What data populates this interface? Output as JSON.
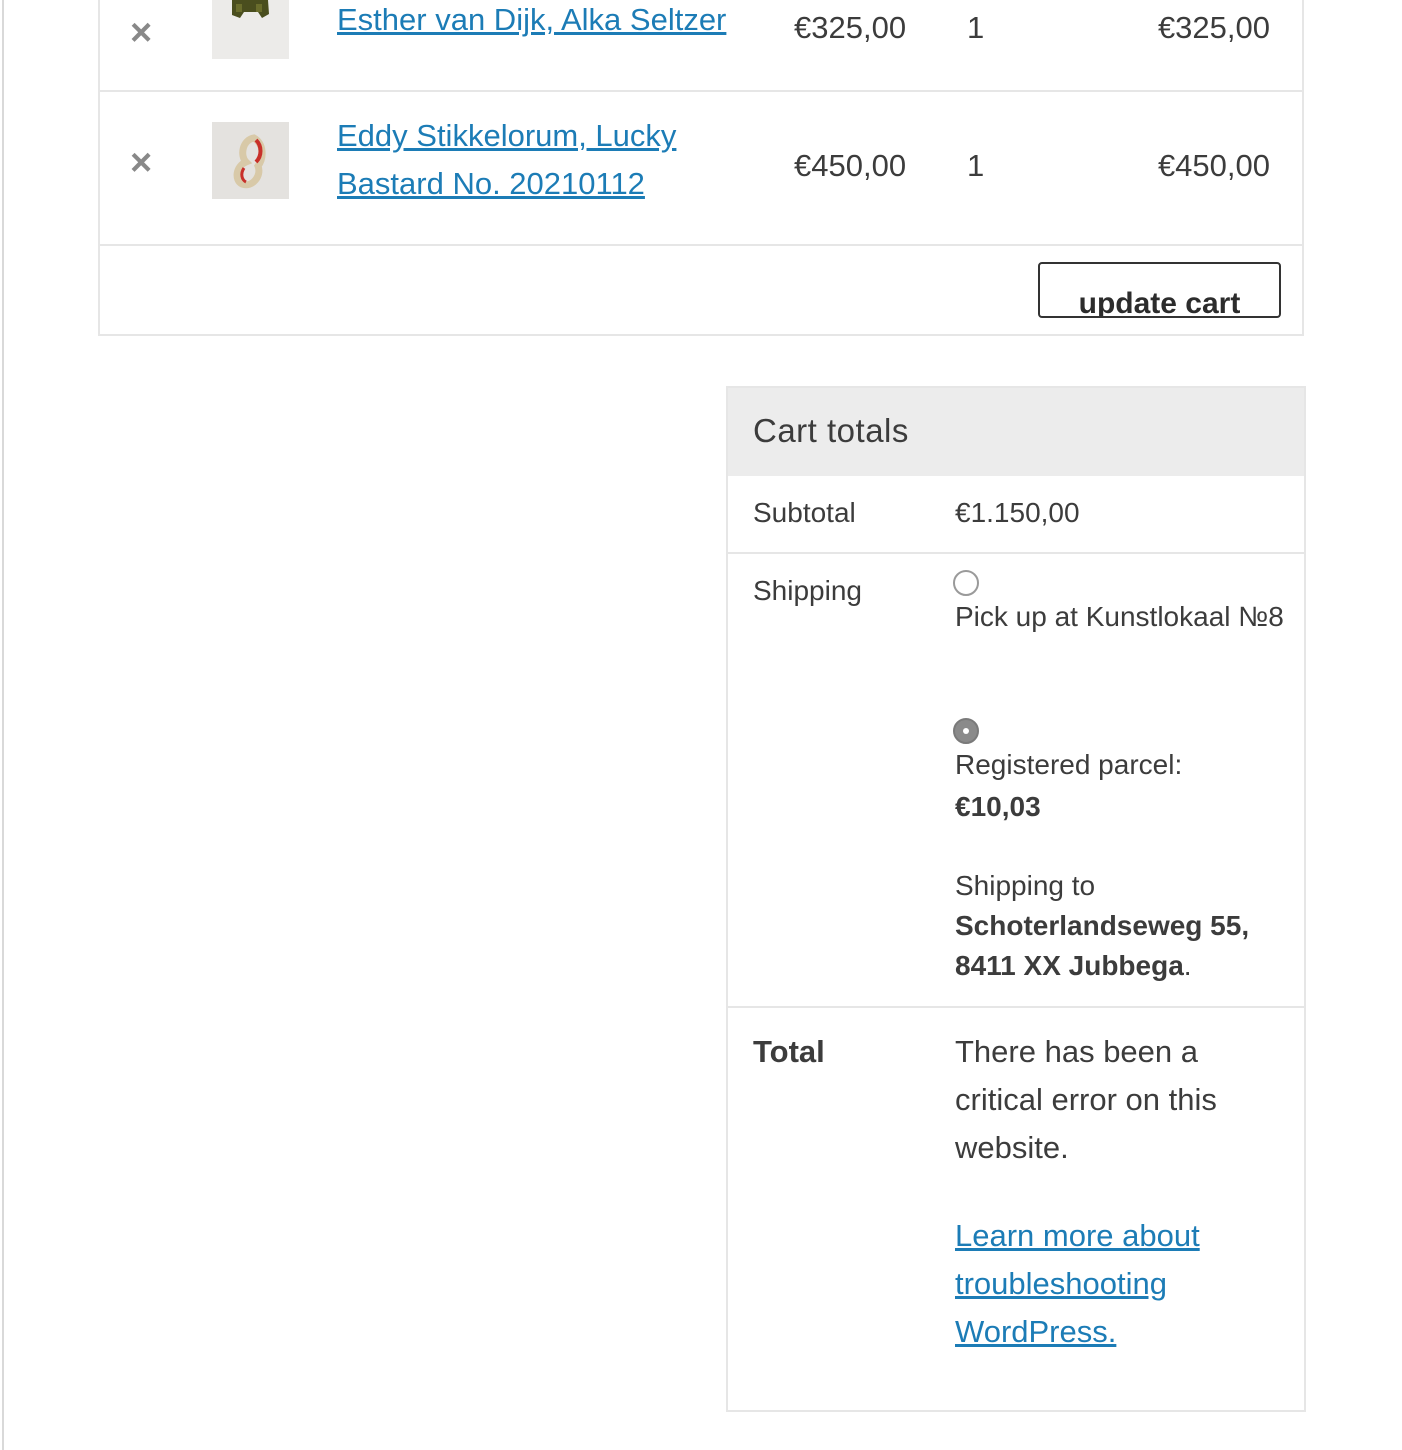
{
  "cart": {
    "items": [
      {
        "remove_label": "×",
        "product_name": "Esther van Dijk, Alka Seltzer",
        "price": "€325,00",
        "quantity": "1",
        "subtotal": "€325,00"
      },
      {
        "remove_label": "×",
        "product_name": "Eddy Stikkelorum, Lucky Bastard No. 20210112",
        "price": "€450,00",
        "quantity": "1",
        "subtotal": "€450,00"
      }
    ],
    "update_cart_label": "update cart"
  },
  "totals": {
    "title": "Cart totals",
    "subtotal_label": "Subtotal",
    "subtotal_value": "€1.150,00",
    "shipping_label": "Shipping",
    "shipping_options": [
      {
        "label": "Pick up at Kunstlokaal №8",
        "selected": false
      },
      {
        "label": "Registered parcel:",
        "price": "€10,03",
        "selected": true
      }
    ],
    "shipping_to_prefix": "Shipping to",
    "shipping_address": "Schoterlandseweg 55, 8411 XX Jubbega",
    "shipping_to_suffix": ".",
    "total_label": "Total",
    "error_message": "There has been a critical error on this website.",
    "learn_more_link": "Learn more about troubleshooting WordPress."
  },
  "colors": {
    "link": "#1c7cb6",
    "header_bg": "#ececec",
    "border": "#e6e6e6",
    "text": "#3c3c3c"
  }
}
